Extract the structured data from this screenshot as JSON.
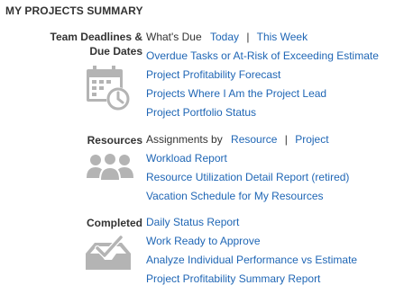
{
  "title": "MY PROJECTS SUMMARY",
  "colors": {
    "link": "#1f66b5",
    "text": "#333333",
    "icon": "#b4b4b4"
  },
  "sections": {
    "deadlines": {
      "label_line1": "Team Deadlines &",
      "label_line2": "Due Dates",
      "icon": "calendar-clock-icon",
      "prefix": "What's Due",
      "today": "Today",
      "sep": "|",
      "this_week": "This Week",
      "links": [
        "Overdue Tasks or At-Risk of Exceeding Estimate",
        "Project Profitability Forecast",
        "Projects Where I Am the Project Lead",
        "Project Portfolio Status"
      ]
    },
    "resources": {
      "label": "Resources",
      "icon": "people-group-icon",
      "prefix": "Assignments by",
      "resource": "Resource",
      "sep": "|",
      "project": "Project",
      "links": [
        "Workload Report",
        "Resource Utilization Detail Report (retired)",
        "Vacation Schedule for My Resources"
      ]
    },
    "completed": {
      "label": "Completed",
      "icon": "inbox-check-icon",
      "links": [
        "Daily Status Report",
        "Work Ready to Approve",
        "Analyze Individual Performance vs Estimate",
        "Project Profitability Summary Report"
      ]
    }
  }
}
